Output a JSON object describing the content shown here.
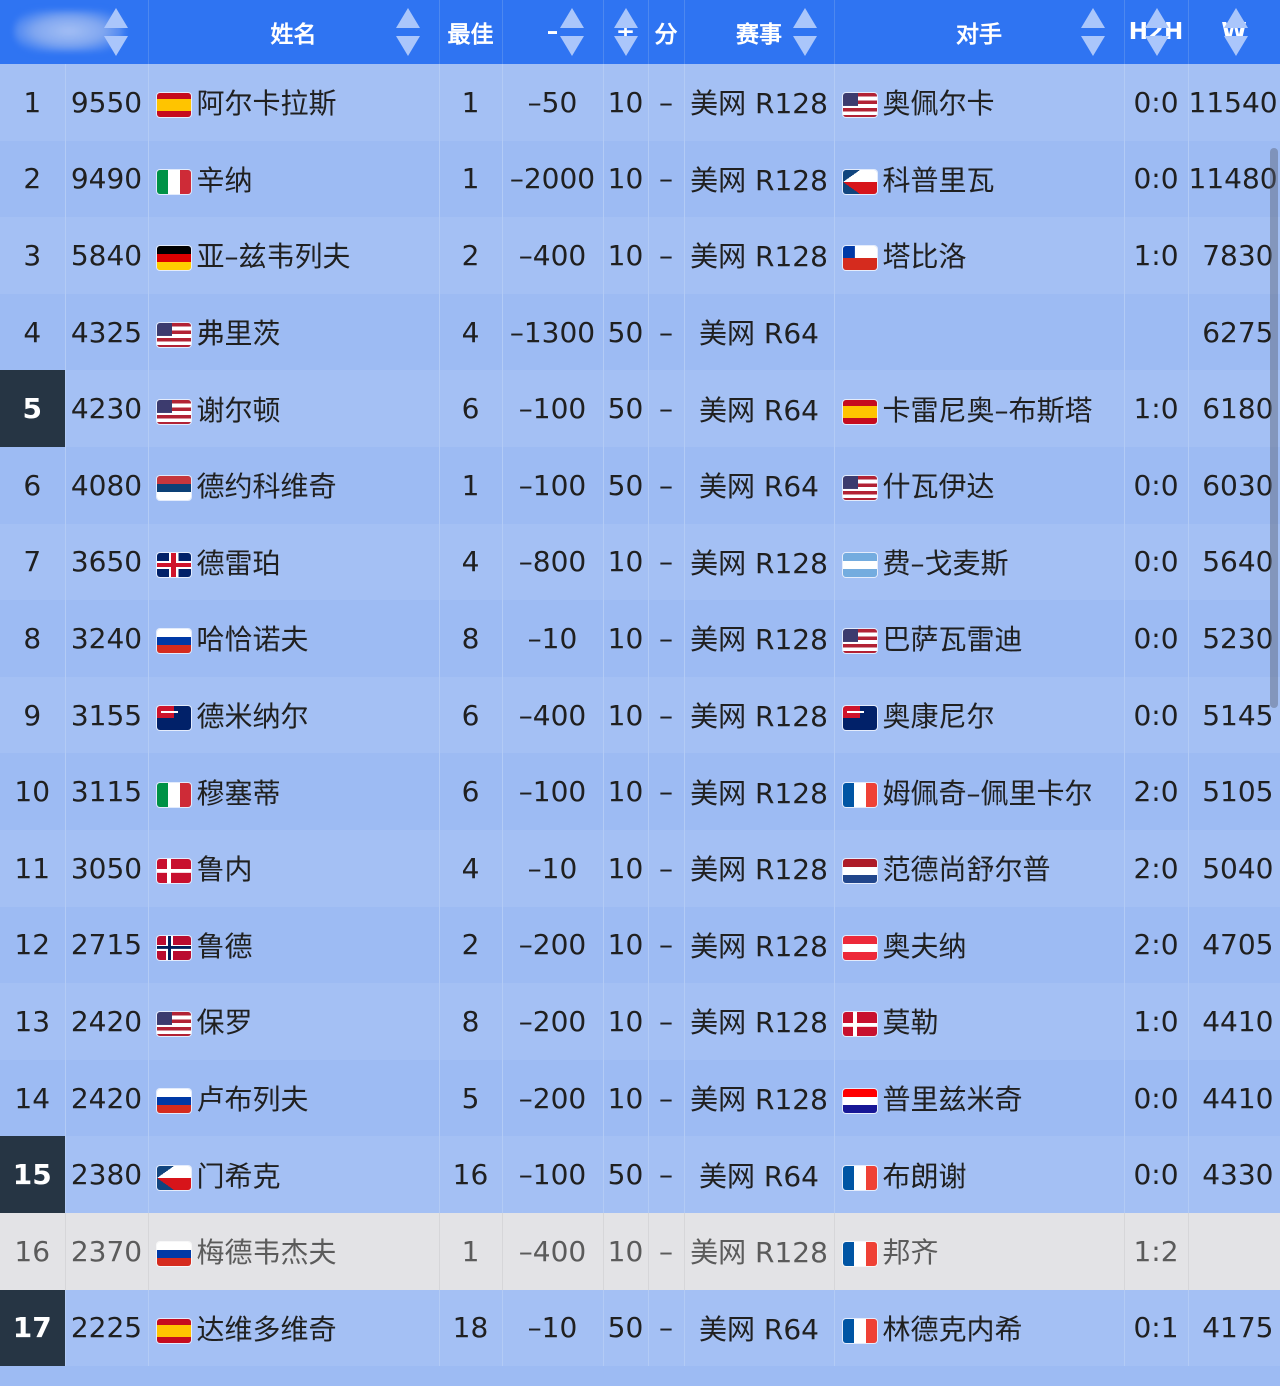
{
  "header": {
    "columns": [
      "",
      "姓名",
      "最佳",
      "–",
      "+",
      "分",
      "赛事",
      "",
      "对手",
      "H2H",
      "W"
    ]
  },
  "rows": [
    {
      "rank": "1",
      "points": "9550",
      "flag": "es",
      "name": "阿尔卡拉斯",
      "best": "1",
      "minus": "–50",
      "plus": "10",
      "dash": "–",
      "event": "美网 R128",
      "opp_flag": "us",
      "opponent": "奥佩尔卡",
      "h2h": "0:0",
      "w": "11540",
      "highlight": false,
      "grey": false
    },
    {
      "rank": "2",
      "points": "9490",
      "flag": "it",
      "name": "辛纳",
      "best": "1",
      "minus": "–2000",
      "plus": "10",
      "dash": "–",
      "event": "美网 R128",
      "opp_flag": "cz",
      "opponent": "科普里瓦",
      "h2h": "0:0",
      "w": "11480",
      "highlight": false,
      "grey": false
    },
    {
      "rank": "3",
      "points": "5840",
      "flag": "de",
      "name": "亚–兹韦列夫",
      "best": "2",
      "minus": "–400",
      "plus": "10",
      "dash": "–",
      "event": "美网 R128",
      "opp_flag": "cl",
      "opponent": "塔比洛",
      "h2h": "1:0",
      "w": "7830",
      "highlight": false,
      "grey": false
    },
    {
      "rank": "4",
      "points": "4325",
      "flag": "us",
      "name": "弗里茨",
      "best": "4",
      "minus": "–1300",
      "plus": "50",
      "dash": "–",
      "event": "美网 R64",
      "opp_flag": "",
      "opponent": "",
      "h2h": "",
      "w": "6275",
      "highlight": false,
      "grey": false
    },
    {
      "rank": "5",
      "points": "4230",
      "flag": "us",
      "name": "谢尔顿",
      "best": "6",
      "minus": "–100",
      "plus": "50",
      "dash": "–",
      "event": "美网 R64",
      "opp_flag": "es",
      "opponent": "卡雷尼奥–布斯塔",
      "h2h": "1:0",
      "w": "6180",
      "highlight": true,
      "grey": false
    },
    {
      "rank": "6",
      "points": "4080",
      "flag": "rs",
      "name": "德约科维奇",
      "best": "1",
      "minus": "–100",
      "plus": "50",
      "dash": "–",
      "event": "美网 R64",
      "opp_flag": "us",
      "opponent": "什瓦伊达",
      "h2h": "0:0",
      "w": "6030",
      "highlight": false,
      "grey": false
    },
    {
      "rank": "7",
      "points": "3650",
      "flag": "gb",
      "name": "德雷珀",
      "best": "4",
      "minus": "–800",
      "plus": "10",
      "dash": "–",
      "event": "美网 R128",
      "opp_flag": "ar",
      "opponent": "费–戈麦斯",
      "h2h": "0:0",
      "w": "5640",
      "highlight": false,
      "grey": false
    },
    {
      "rank": "8",
      "points": "3240",
      "flag": "ru",
      "name": "哈恰诺夫",
      "best": "8",
      "minus": "–10",
      "plus": "10",
      "dash": "–",
      "event": "美网 R128",
      "opp_flag": "us",
      "opponent": "巴萨瓦雷迪",
      "h2h": "0:0",
      "w": "5230",
      "highlight": false,
      "grey": false
    },
    {
      "rank": "9",
      "points": "3155",
      "flag": "au",
      "name": "德米纳尔",
      "best": "6",
      "minus": "–400",
      "plus": "10",
      "dash": "–",
      "event": "美网 R128",
      "opp_flag": "au",
      "opponent": "奥康尼尔",
      "h2h": "0:0",
      "w": "5145",
      "highlight": false,
      "grey": false
    },
    {
      "rank": "10",
      "points": "3115",
      "flag": "it",
      "name": "穆塞蒂",
      "best": "6",
      "minus": "–100",
      "plus": "10",
      "dash": "–",
      "event": "美网 R128",
      "opp_flag": "fr",
      "opponent": "姆佩奇–佩里卡尔",
      "h2h": "2:0",
      "w": "5105",
      "highlight": false,
      "grey": false
    },
    {
      "rank": "11",
      "points": "3050",
      "flag": "dk",
      "name": "鲁内",
      "best": "4",
      "minus": "–10",
      "plus": "10",
      "dash": "–",
      "event": "美网 R128",
      "opp_flag": "nl",
      "opponent": "范德尚舒尔普",
      "h2h": "2:0",
      "w": "5040",
      "highlight": false,
      "grey": false
    },
    {
      "rank": "12",
      "points": "2715",
      "flag": "no",
      "name": "鲁德",
      "best": "2",
      "minus": "–200",
      "plus": "10",
      "dash": "–",
      "event": "美网 R128",
      "opp_flag": "at",
      "opponent": "奥夫纳",
      "h2h": "2:0",
      "w": "4705",
      "highlight": false,
      "grey": false
    },
    {
      "rank": "13",
      "points": "2420",
      "flag": "us",
      "name": "保罗",
      "best": "8",
      "minus": "–200",
      "plus": "10",
      "dash": "–",
      "event": "美网 R128",
      "opp_flag": "dk",
      "opponent": "莫勒",
      "h2h": "1:0",
      "w": "4410",
      "highlight": false,
      "grey": false
    },
    {
      "rank": "14",
      "points": "2420",
      "flag": "ru",
      "name": "卢布列夫",
      "best": "5",
      "minus": "–200",
      "plus": "10",
      "dash": "–",
      "event": "美网 R128",
      "opp_flag": "hr",
      "opponent": "普里兹米奇",
      "h2h": "0:0",
      "w": "4410",
      "highlight": false,
      "grey": false
    },
    {
      "rank": "15",
      "points": "2380",
      "flag": "cz",
      "name": "门希克",
      "best": "16",
      "minus": "–100",
      "plus": "50",
      "dash": "–",
      "event": "美网 R64",
      "opp_flag": "fr",
      "opponent": "布朗谢",
      "h2h": "0:0",
      "w": "4330",
      "highlight": true,
      "grey": false
    },
    {
      "rank": "16",
      "points": "2370",
      "flag": "ru",
      "name": "梅德韦杰夫",
      "best": "1",
      "minus": "–400",
      "plus": "10",
      "dash": "–",
      "event": "美网 R128",
      "opp_flag": "fr",
      "opponent": "邦齐",
      "h2h": "1:2",
      "w": "",
      "highlight": false,
      "grey": true
    },
    {
      "rank": "17",
      "points": "2225",
      "flag": "es",
      "name": "达维多维奇",
      "best": "18",
      "minus": "–10",
      "plus": "50",
      "dash": "–",
      "event": "美网 R64",
      "opp_flag": "fr",
      "opponent": "林德克内希",
      "h2h": "0:1",
      "w": "4175",
      "highlight": true,
      "grey": false
    }
  ]
}
